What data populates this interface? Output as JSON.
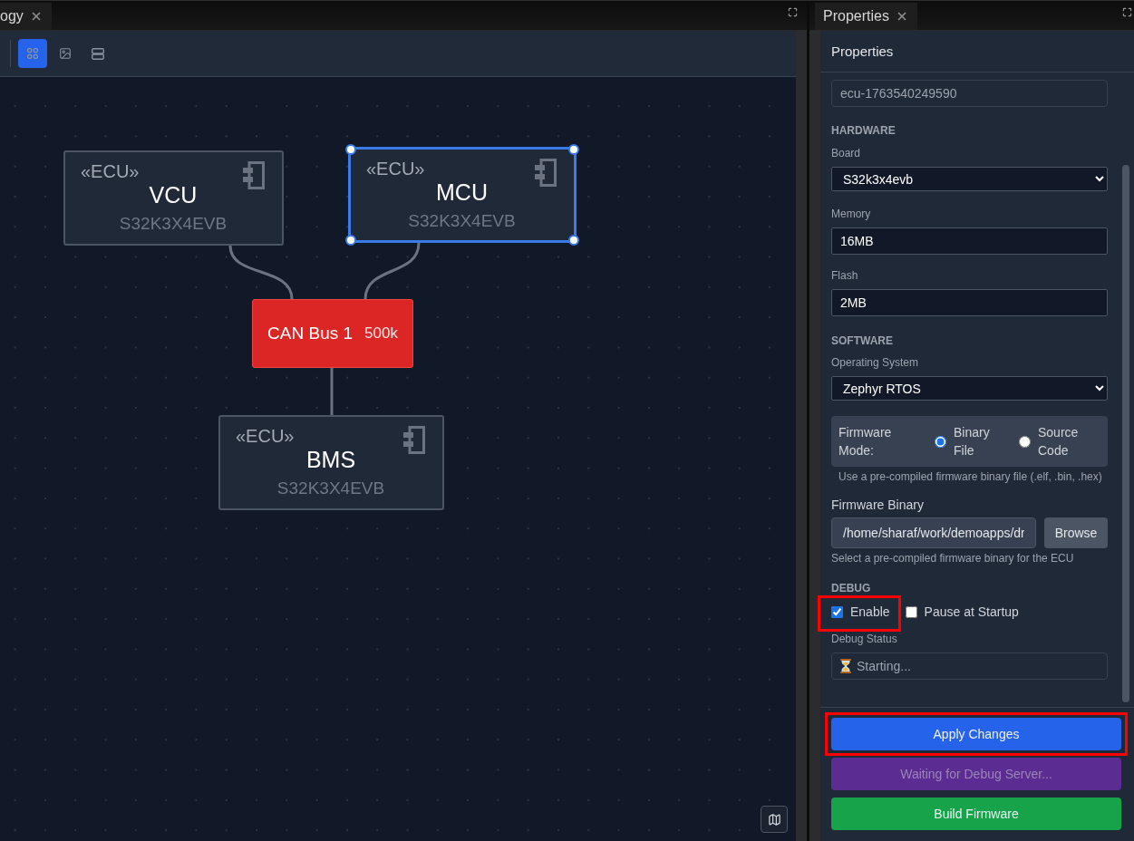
{
  "topology_panel": {
    "tab": {
      "label": "ogy"
    },
    "toolbar": {
      "buttons": [
        {
          "kind": "grid",
          "selected": true
        },
        {
          "kind": "image",
          "selected": false
        },
        {
          "kind": "server",
          "selected": false
        }
      ]
    },
    "diagram": {
      "nodes": [
        {
          "kind": "ecu",
          "stereotype": "«ECU»",
          "name": "VCU",
          "board": "S32K3X4EVB",
          "selected": false
        },
        {
          "kind": "ecu",
          "stereotype": "«ECU»",
          "name": "MCU",
          "board": "S32K3X4EVB",
          "selected": true
        },
        {
          "kind": "bus",
          "name": "CAN Bus 1",
          "speed": "500k",
          "selected": false
        },
        {
          "kind": "ecu",
          "stereotype": "«ECU»",
          "name": "BMS",
          "board": "S32K3X4EVB",
          "selected": false
        }
      ]
    }
  },
  "properties_panel": {
    "tab": {
      "label": "Properties"
    },
    "header": "Properties",
    "name_field": {
      "value": "ecu-1763540249590"
    },
    "hardware": {
      "heading": "HARDWARE",
      "board": {
        "label": "Board",
        "value": "S32k3x4evb"
      },
      "memory": {
        "label": "Memory",
        "value": "16MB"
      },
      "flash": {
        "label": "Flash",
        "value": "2MB"
      }
    },
    "software": {
      "heading": "SOFTWARE",
      "os": {
        "label": "Operating System",
        "value": "Zephyr RTOS"
      },
      "firmware_mode": {
        "label": "Firmware Mode:",
        "options": [
          {
            "label": "Binary File",
            "selected": true
          },
          {
            "label": "Source Code",
            "selected": false
          }
        ],
        "hint": "Use a pre-compiled firmware binary file (.elf, .bin, .hex)"
      },
      "firmware_binary": {
        "label": "Firmware Binary",
        "value": "/home/sharaf/work/demoapps/dr",
        "button": "Browse",
        "hint": "Select a pre-compiled firmware binary for the ECU"
      }
    },
    "debug": {
      "heading": "DEBUG",
      "options": [
        {
          "label": "Enable",
          "checked": true,
          "highlighted": true
        },
        {
          "label": "Pause at Startup",
          "checked": false,
          "highlighted": false
        }
      ],
      "status": {
        "label": "Debug Status",
        "value": "Starting..."
      }
    },
    "actions": [
      {
        "label": "Apply Changes",
        "kind": "apply",
        "disabled": false,
        "highlighted": true
      },
      {
        "label": "Waiting for Debug Server...",
        "kind": "debug",
        "disabled": true,
        "highlighted": false
      },
      {
        "label": "Build Firmware",
        "kind": "build",
        "disabled": false,
        "highlighted": false
      }
    ]
  }
}
